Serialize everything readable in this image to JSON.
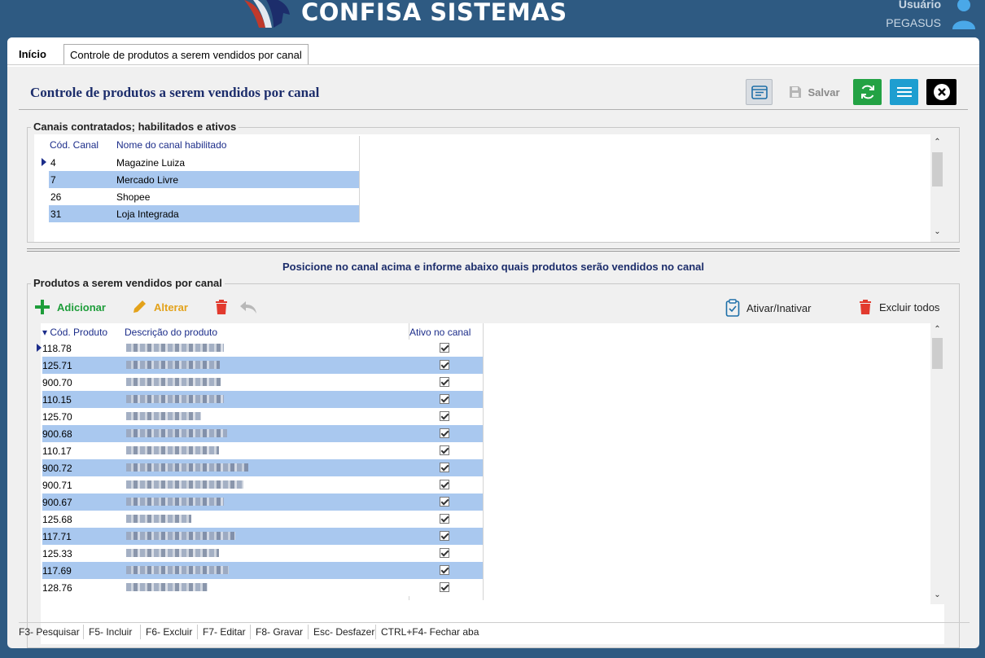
{
  "header": {
    "brand": "CONFISA SISTEMAS",
    "user_label": "Usuário",
    "user_name": "PEGASUS"
  },
  "tabs": [
    {
      "label": "Início"
    },
    {
      "label": "Controle de produtos a serem vendidos por canal"
    }
  ],
  "page": {
    "title": "Controle de produtos a serem vendidos por canal",
    "toolbar": {
      "save_label": "Salvar"
    }
  },
  "channels": {
    "group_label": "Canais contratados; habilitados e ativos",
    "columns": [
      "Cód. Canal",
      "Nome do canal habilitado"
    ],
    "rows": [
      {
        "code": "4",
        "name": "Magazine Luiza"
      },
      {
        "code": "7",
        "name": "Mercado Livre"
      },
      {
        "code": "26",
        "name": "Shopee"
      },
      {
        "code": "31",
        "name": "Loja Integrada"
      }
    ]
  },
  "hint": "Posicione no canal acima e informe abaixo quais produtos serão vendidos no canal",
  "products": {
    "group_label": "Produtos a serem vendidos por canal",
    "actions": {
      "add": "Adicionar",
      "edit": "Alterar",
      "toggle": "Ativar/Inativar",
      "delete_all": "Excluir todos"
    },
    "columns": [
      "Cód. Produto",
      "Descrição do produto",
      "Ativo no canal"
    ],
    "rows": [
      {
        "code": "118.78",
        "active": true
      },
      {
        "code": "125.71",
        "active": true
      },
      {
        "code": "900.70",
        "active": true
      },
      {
        "code": "110.15",
        "active": true
      },
      {
        "code": "125.70",
        "active": true
      },
      {
        "code": "900.68",
        "active": true
      },
      {
        "code": "110.17",
        "active": true
      },
      {
        "code": "900.72",
        "active": true
      },
      {
        "code": "900.71",
        "active": true
      },
      {
        "code": "900.67",
        "active": true
      },
      {
        "code": "125.68",
        "active": true
      },
      {
        "code": "117.71",
        "active": true
      },
      {
        "code": "125.33",
        "active": true
      },
      {
        "code": "117.69",
        "active": true
      },
      {
        "code": "128.76",
        "active": true
      }
    ]
  },
  "statusbar": [
    "F3- Pesquisar",
    "F5- Incluir",
    "F6- Excluir",
    "F7- Editar",
    "F8- Gravar",
    "Esc- Desfazer",
    "CTRL+F4- Fechar aba"
  ],
  "colors": {
    "background": "#2e5a82",
    "selected_row": "#a9c8ef",
    "title": "#1c2d6b",
    "add": "#1e9d3a",
    "edit": "#e3a21a",
    "refresh": "#23a244",
    "menu": "#1e9ed0"
  },
  "icons": [
    "logo-icon",
    "user-icon",
    "calendar-icon",
    "save-icon",
    "refresh-icon",
    "menu-icon",
    "close-icon",
    "plus-icon",
    "pencil-icon",
    "trash-icon",
    "undo-icon",
    "clipboard-check-icon"
  ]
}
